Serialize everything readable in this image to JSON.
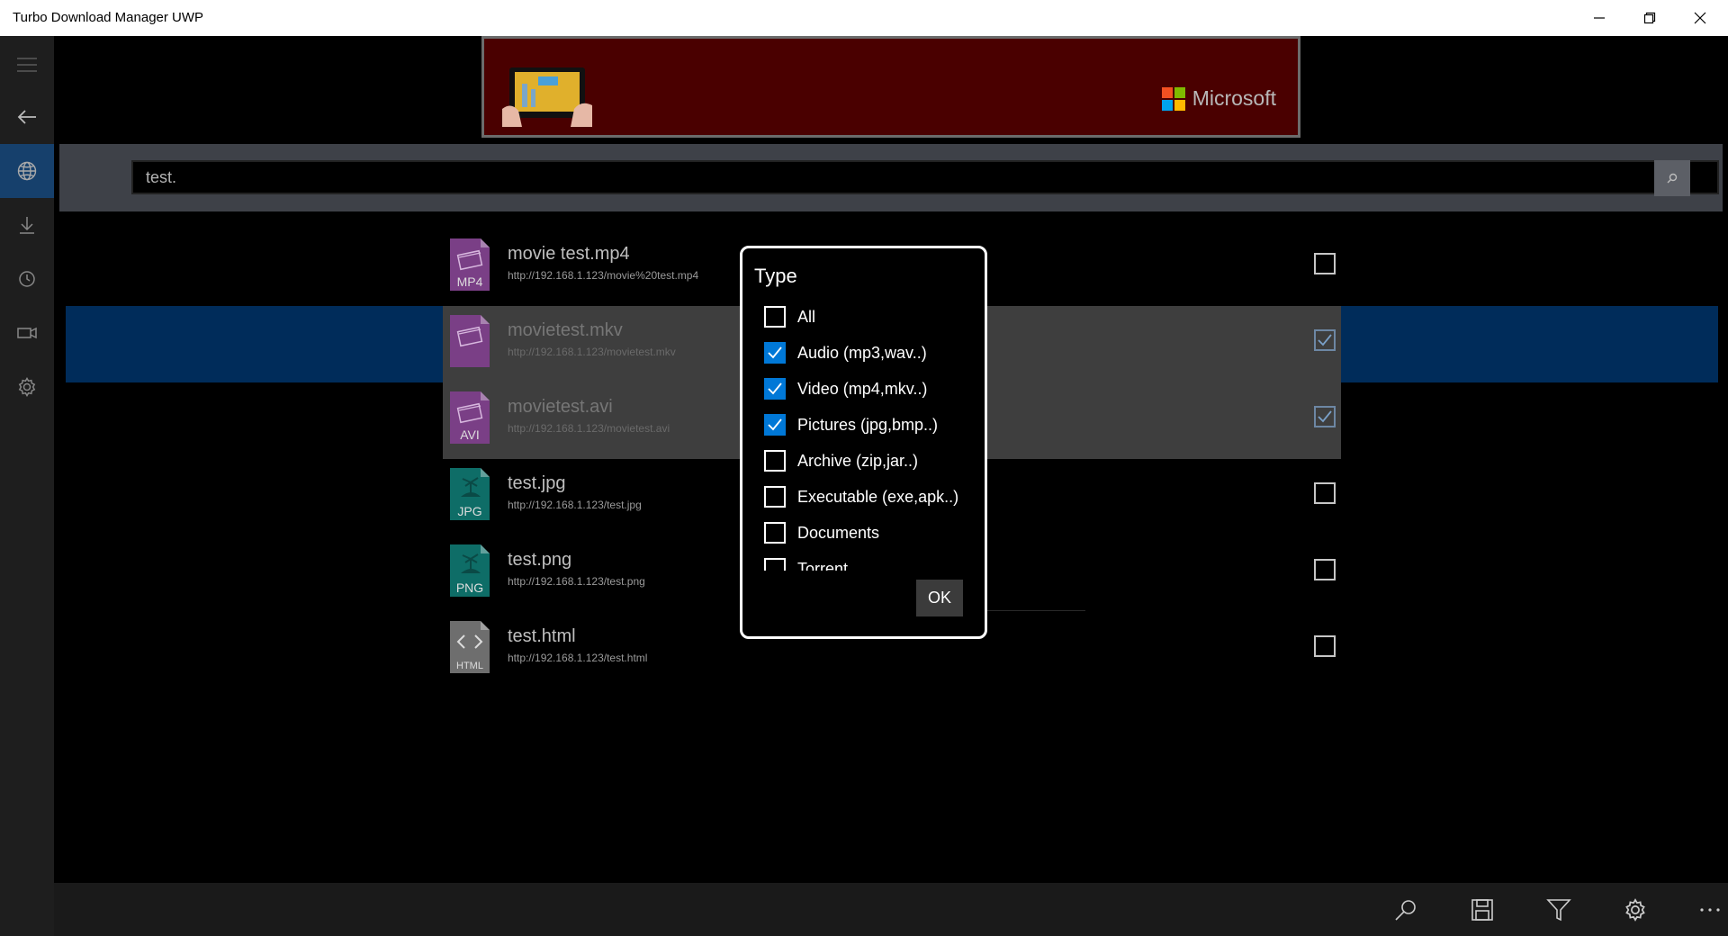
{
  "window": {
    "title": "Turbo Download Manager UWP"
  },
  "nav": {
    "items": [
      {
        "name": "menu-icon"
      },
      {
        "name": "back-icon"
      },
      {
        "name": "globe-icon",
        "active": true
      },
      {
        "name": "download-icon"
      },
      {
        "name": "history-icon"
      },
      {
        "name": "video-icon"
      },
      {
        "name": "gear-icon"
      }
    ]
  },
  "ad": {
    "brand": "Microsoft",
    "colors": [
      "#f25022",
      "#7fba00",
      "#00a4ef",
      "#ffb900"
    ]
  },
  "search": {
    "value": "test."
  },
  "files": [
    {
      "name": "movie test.mp4",
      "url": "http://192.168.1.123/movie%20test.mp4",
      "ext": "MP4",
      "kind": "video",
      "checked": false
    },
    {
      "name": "movietest.mkv",
      "url": "http://192.168.1.123/movietest.mkv",
      "ext": "",
      "kind": "video",
      "checked": true
    },
    {
      "name": "movietest.avi",
      "url": "http://192.168.1.123/movietest.avi",
      "ext": "AVI",
      "kind": "video",
      "checked": true
    },
    {
      "name": "test.jpg",
      "url": "http://192.168.1.123/test.jpg",
      "ext": "JPG",
      "kind": "image",
      "checked": false
    },
    {
      "name": "test.png",
      "url": "http://192.168.1.123/test.png",
      "ext": "PNG",
      "kind": "image",
      "checked": false
    },
    {
      "name": "test.html",
      "url": "http://192.168.1.123/test.html",
      "ext": "HTML",
      "kind": "html",
      "checked": false
    }
  ],
  "dialog": {
    "title": "Type",
    "options": [
      {
        "label": "All",
        "checked": false
      },
      {
        "label": "Audio (mp3,wav..)",
        "checked": true
      },
      {
        "label": "Video (mp4,mkv..)",
        "checked": true
      },
      {
        "label": "Pictures (jpg,bmp..)",
        "checked": true
      },
      {
        "label": "Archive (zip,jar..)",
        "checked": false
      },
      {
        "label": "Executable (exe,apk..)",
        "checked": false
      },
      {
        "label": "Documents",
        "checked": false
      },
      {
        "label": "Torrent",
        "checked": false
      }
    ],
    "ok_label": "OK"
  },
  "appbar": {
    "buttons": [
      "search-icon",
      "save-icon",
      "filter-icon",
      "gear-icon",
      "more-icon"
    ]
  },
  "colors": {
    "accent": "#0078d7",
    "nav_active": "#16406c",
    "video_icon": "#7a3f86",
    "image_icon": "#0e6d67",
    "html_icon": "#6e6e6e"
  }
}
